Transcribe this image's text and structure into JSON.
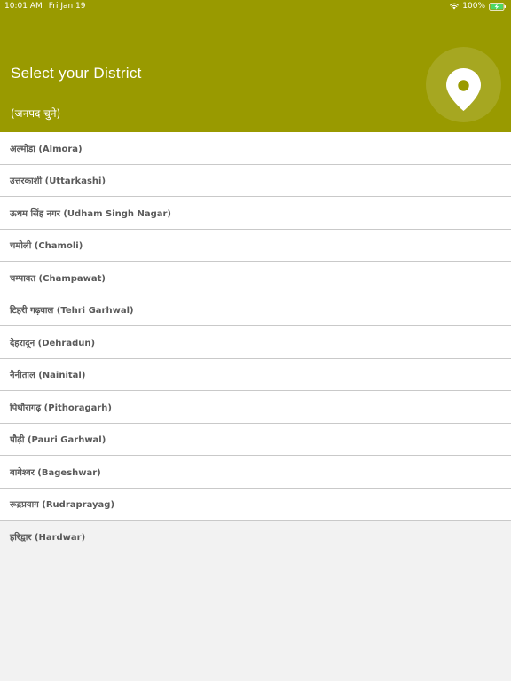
{
  "status_bar": {
    "time": "10:01 AM",
    "date": "Fri Jan 19",
    "battery": "100%"
  },
  "header": {
    "title": "Select your District",
    "subtitle": "(जनपद चुने)",
    "icon": "location-pin-icon",
    "background_color": "#999a00"
  },
  "districts": [
    {
      "label": "अल्मोडा (Almora)"
    },
    {
      "label": "उत्तरकाशी (Uttarkashi)"
    },
    {
      "label": "ऊधम सिंह नगर (Udham Singh Nagar)"
    },
    {
      "label": "चमोली (Chamoli)"
    },
    {
      "label": "चम्पावत (Champawat)"
    },
    {
      "label": "टिहरी गढ़वाल (Tehri Garhwal)"
    },
    {
      "label": "देहरादून (Dehradun)"
    },
    {
      "label": "नैनीताल (Nainital)"
    },
    {
      "label": "पिथौरागढ़ (Pithoragarh)"
    },
    {
      "label": "पौढ़ी (Pauri Garhwal)"
    },
    {
      "label": "बागेश्वर (Bageshwar)"
    },
    {
      "label": "रूद्रप्रयाग (Rudraprayag)"
    },
    {
      "label": "हरिद्वार (Hardwar)"
    }
  ]
}
